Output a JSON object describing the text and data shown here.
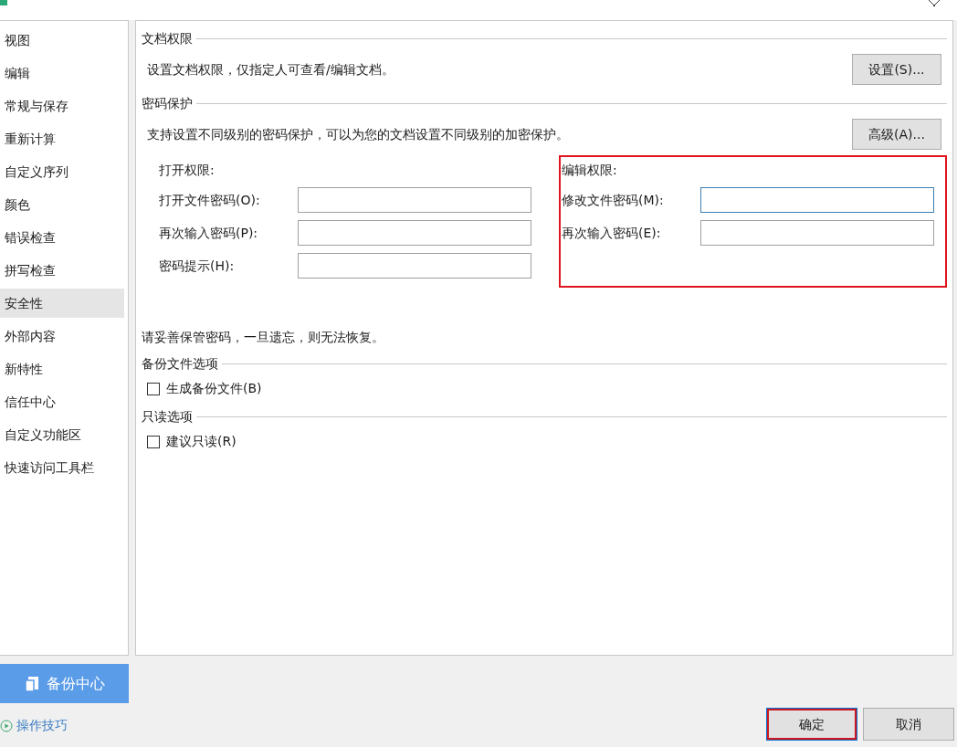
{
  "sidebar": {
    "items": [
      {
        "label": "视图",
        "selected": false
      },
      {
        "label": "编辑",
        "selected": false
      },
      {
        "label": "常规与保存",
        "selected": false
      },
      {
        "label": "重新计算",
        "selected": false
      },
      {
        "label": "自定义序列",
        "selected": false
      },
      {
        "label": "颜色",
        "selected": false
      },
      {
        "label": "错误检查",
        "selected": false
      },
      {
        "label": "拼写检查",
        "selected": false
      },
      {
        "label": "安全性",
        "selected": true
      },
      {
        "label": "外部内容",
        "selected": false
      },
      {
        "label": "新特性",
        "selected": false
      },
      {
        "label": "信任中心",
        "selected": false
      },
      {
        "label": "自定义功能区",
        "selected": false
      },
      {
        "label": "快速访问工具栏",
        "selected": false
      }
    ],
    "backup_button": "备份中心",
    "tips_link": "操作技巧"
  },
  "document_permission": {
    "heading": "文档权限",
    "description": "设置文档权限，仅指定人可查看/编辑文档。",
    "button": "设置(S)..."
  },
  "password_protection": {
    "heading": "密码保护",
    "description": "支持设置不同级别的密码保护，可以为您的文档设置不同级别的加密保护。",
    "button": "高级(A)...",
    "open_group": {
      "title": "打开权限:",
      "highlighted": false,
      "fields": [
        {
          "label": "打开文件密码(O):",
          "focused": false
        },
        {
          "label": "再次输入密码(P):",
          "focused": false
        },
        {
          "label": "密码提示(H):",
          "focused": false
        }
      ]
    },
    "edit_group": {
      "title": "编辑权限:",
      "highlighted": true,
      "fields": [
        {
          "label": "修改文件密码(M):",
          "focused": true
        },
        {
          "label": "再次输入密码(E):",
          "focused": false
        }
      ]
    },
    "warning": "请妥善保管密码，一旦遗忘，则无法恢复。"
  },
  "backup_options": {
    "heading": "备份文件选项",
    "checkbox": {
      "label": "生成备份文件(B)",
      "checked": false
    }
  },
  "readonly_options": {
    "heading": "只读选项",
    "checkbox": {
      "label": "建议只读(R)",
      "checked": false
    }
  },
  "footer": {
    "buttons": [
      {
        "label": "确定",
        "default": true,
        "highlighted": true
      },
      {
        "label": "取消",
        "default": false,
        "highlighted": false
      }
    ]
  }
}
